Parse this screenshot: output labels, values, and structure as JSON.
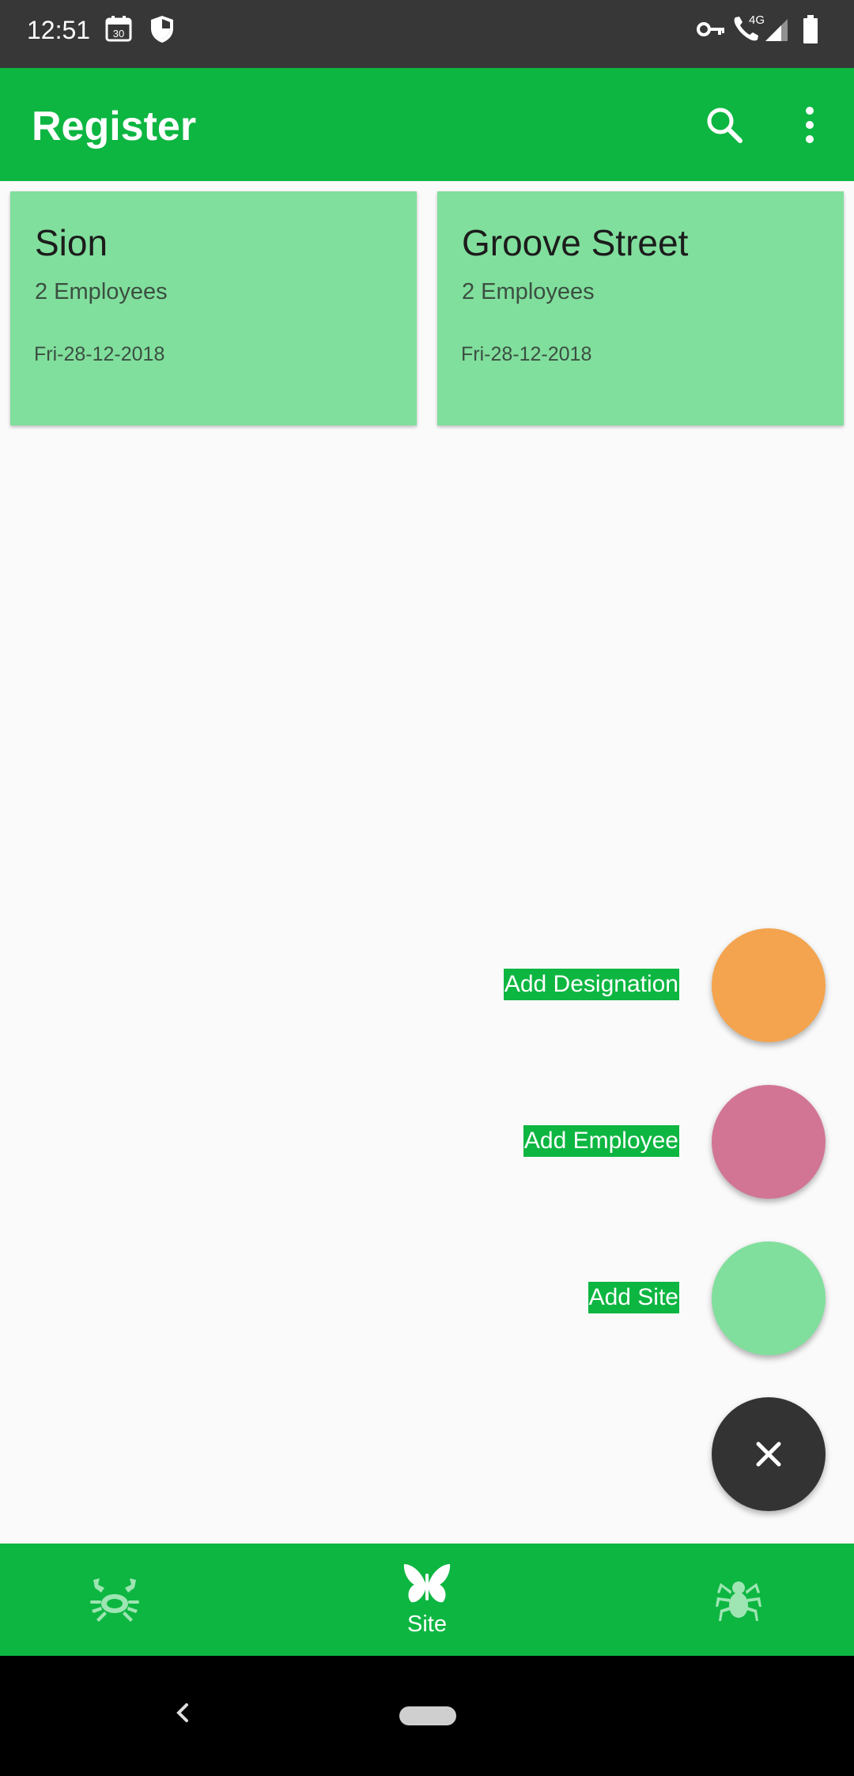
{
  "status_bar": {
    "time": "12:51",
    "calendar_day": "30",
    "network": "4G",
    "icons": [
      "calendar-icon",
      "shield-icon",
      "vpn-key-icon",
      "wifi-calling-icon",
      "signal-icon",
      "battery-icon"
    ]
  },
  "app_bar": {
    "title": "Register",
    "color": "#0db641",
    "actions": [
      "search-icon",
      "more-vert-icon"
    ]
  },
  "sites": [
    {
      "name": "Sion",
      "employees": "2 Employees",
      "date": "Fri-28-12-2018"
    },
    {
      "name": "Groove Street",
      "employees": "2 Employees",
      "date": "Fri-28-12-2018"
    }
  ],
  "fab_menu": {
    "items": [
      {
        "label": "Add Designation",
        "color": "#f4a44e"
      },
      {
        "label": "Add Employee",
        "color": "#d27595"
      },
      {
        "label": "Add Site",
        "color": "#80df9c"
      }
    ],
    "close_color": "#333333",
    "close_icon": "close-icon"
  },
  "bottom_nav": {
    "items": [
      {
        "icon": "crab-icon",
        "label": ""
      },
      {
        "icon": "butterfly-icon",
        "label": "Site"
      },
      {
        "icon": "spider-icon",
        "label": ""
      }
    ],
    "active_index": 1
  }
}
